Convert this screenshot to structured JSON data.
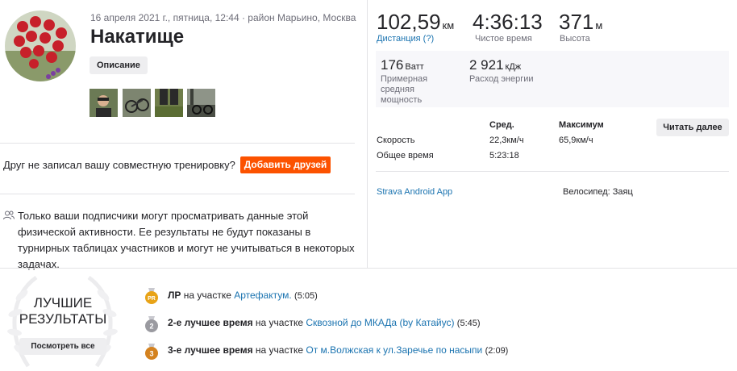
{
  "activity": {
    "meta": "16 апреля 2021 г., пятница, 12:44 · район Марьино, Москва",
    "title": "Накатище",
    "description_button": "Описание"
  },
  "friends": {
    "text": "Друг не записал вашу совместную тренировку?",
    "button": "Добавить друзей"
  },
  "privacy": {
    "text": "Только ваши подписчики могут просматривать данные этой физической активности. Ее результаты не будут показаны в турнирных таблицах участников и могут не учитываться в некоторых задачах."
  },
  "stats": {
    "distance_value": "102,59",
    "distance_unit": "км",
    "distance_label": "Дистанция (?)",
    "moving_time_value": "4:36:13",
    "moving_time_label": "Чистое время",
    "elevation_value": "371",
    "elevation_unit": "м",
    "elevation_label": "Высота",
    "power_value": "176",
    "power_unit": "Ватт",
    "power_label": "Примерная средняя мощность",
    "energy_value": "2 921",
    "energy_unit": "кДж",
    "energy_label": "Расход энергии"
  },
  "details": {
    "col_avg": "Сред.",
    "col_max": "Максимум",
    "speed_label": "Скорость",
    "speed_avg": "22,3км/ч",
    "speed_max": "65,9км/ч",
    "elapsed_label": "Общее время",
    "elapsed_avg": "5:23:18",
    "read_more": "Читать далее",
    "device": "Strava Android App",
    "bike": "Велосипед: Заяц"
  },
  "best_efforts": {
    "title_line1": "ЛУЧШИЕ",
    "title_line2": "РЕЗУЛЬТАТЫ",
    "button": "Посмотреть все",
    "items": [
      {
        "rank": "ЛР",
        "on_segment": " на участке ",
        "segment": "Артефактум.",
        "time": "(5:05)",
        "medal": "PR"
      },
      {
        "rank": "2-е лучшее время",
        "on_segment": " на участке ",
        "segment": "Сквозной до МКАДа (by Катайус)",
        "time": "(5:45)",
        "medal": "2"
      },
      {
        "rank": "3-е лучшее время",
        "on_segment": " на участке ",
        "segment": "От м.Волжская к ул.Заречье по насыпи",
        "time": "(2:09)",
        "medal": "3"
      }
    ]
  },
  "colors": {
    "accent": "#fc5200",
    "link": "#1a73b0",
    "medal_gold": "#e8a317",
    "medal_silver": "#9a9aa0",
    "medal_bronze": "#d4821f"
  }
}
